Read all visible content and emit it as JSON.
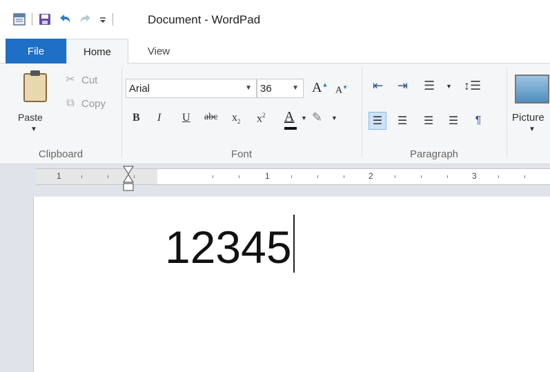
{
  "window": {
    "title": "Document - WordPad"
  },
  "ribbon_tabs": [
    {
      "label": "File"
    },
    {
      "label": "Home"
    },
    {
      "label": "View"
    }
  ],
  "clipboard": {
    "group_label": "Clipboard",
    "paste_label": "Paste",
    "cut_label": "Cut",
    "copy_label": "Copy"
  },
  "font": {
    "group_label": "Font",
    "family": "Arial",
    "size": "36"
  },
  "paragraph": {
    "group_label": "Paragraph"
  },
  "insert": {
    "picture_label": "Picture"
  },
  "ruler": {
    "numbers": [
      "1",
      "1",
      "2",
      "3"
    ]
  },
  "document": {
    "text": "12345"
  },
  "colors": {
    "file_tab": "#1e6fc6",
    "ribbon_bg": "#f5f6f7",
    "align_active": "#cde3f7"
  }
}
